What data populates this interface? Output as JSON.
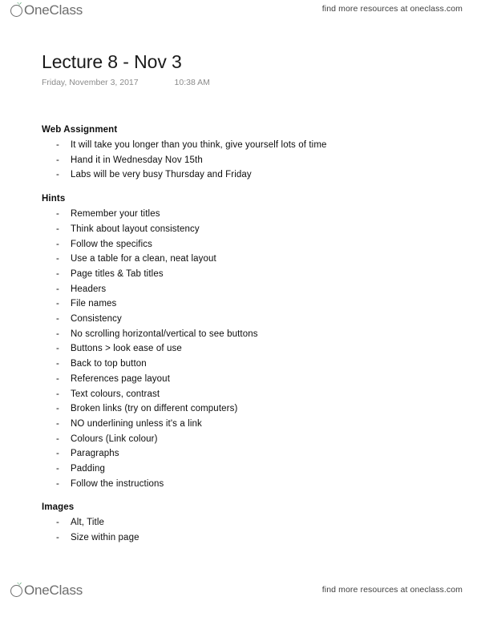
{
  "header": {
    "brand_name": "OneClass",
    "brand_logo_icon": "oneclass-sprout-logo",
    "tagline": "find more resources at oneclass.com"
  },
  "document": {
    "title": "Lecture 8 - Nov 3",
    "date": "Friday, November 3, 2017",
    "time": "10:38 AM",
    "sections": [
      {
        "heading": "Web Assignment",
        "items": [
          "It will take you longer than you think, give yourself lots of time",
          "Hand it in Wednesday Nov 15th",
          "Labs will be very busy Thursday and Friday"
        ]
      },
      {
        "heading": "Hints",
        "items": [
          "Remember your titles",
          "Think about layout consistency",
          "Follow the specifics",
          "Use a table for a clean, neat layout",
          "Page titles & Tab titles",
          "Headers",
          "File names",
          "Consistency",
          "No scrolling horizontal/vertical to see buttons",
          "Buttons > look ease of use",
          "Back to top button",
          "References page layout",
          "Text colours, contrast",
          "Broken links (try on different computers)",
          "NO underlining unless it's a link",
          "Colours (Link colour)",
          "Paragraphs",
          "Padding",
          "Follow the instructions"
        ]
      },
      {
        "heading": "Images",
        "items": [
          "Alt, Title",
          "Size within page"
        ]
      }
    ],
    "bullet_marker": "-"
  },
  "footer": {
    "brand_name": "OneClass",
    "brand_logo_icon": "oneclass-sprout-logo",
    "tagline": "find more resources at oneclass.com"
  },
  "colors": {
    "brand_gray": "#6d6d6d",
    "leaf_green": "#2f8f4e",
    "text": "#0d0d0d",
    "muted": "#8b8b8b",
    "tagline": "#3f3f3f"
  }
}
